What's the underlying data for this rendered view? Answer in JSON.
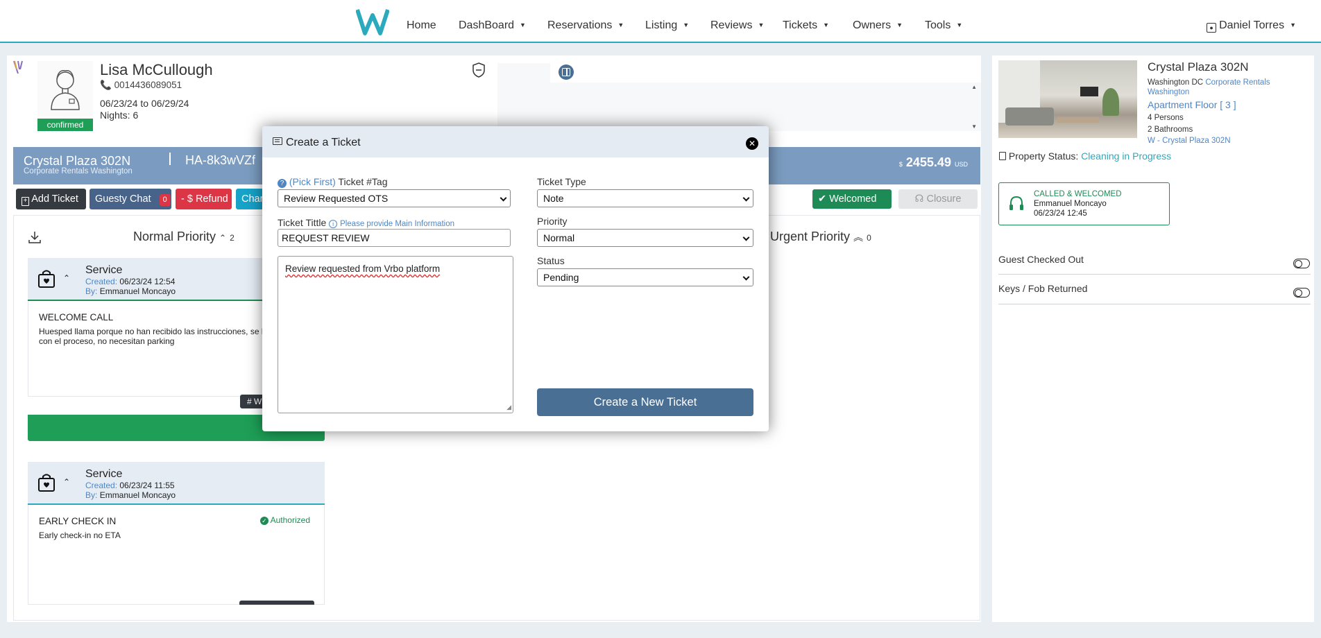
{
  "nav": {
    "items": [
      "Home",
      "DashBoard",
      "Reservations",
      "Listing",
      "Reviews",
      "Tickets",
      "Owners",
      "Tools"
    ],
    "user": "Daniel Torres"
  },
  "guest": {
    "name": "Lisa McCullough",
    "phone": "0014436089051",
    "dates": "06/23/24 to 06/29/24",
    "nights": "Nights: 6",
    "status": "confirmed"
  },
  "reservation_bar": {
    "property": "Crystal Plaza 302N",
    "subtitle": "Corporate Rentals Washington",
    "code": "HA-8k3wVZf",
    "price_symbol": "$",
    "price": "2455.49",
    "currency": "USD"
  },
  "actions": {
    "add_ticket": "Add Ticket",
    "guesty_chat": "Guesty Chat",
    "chat_count": "0",
    "refund": "- $ Refund",
    "charge": "Char",
    "welcomed": "Welcomed",
    "closure": "Closure"
  },
  "columns": {
    "normal": "Normal Priority",
    "normal_count": "2",
    "urgent": "Urgent Priority",
    "urgent_count": "0"
  },
  "tickets": [
    {
      "type": "Service",
      "created_label": "Created:",
      "created": "06/23/24 12:54",
      "by_label": "By:",
      "by": "Emmanuel Moncayo",
      "title": "WELCOME CALL",
      "body_line1": "Huesped llama porque no han recibido las instrucciones, se l",
      "body_line2": "con el proceso, no necesitan parking",
      "tag": "# W"
    },
    {
      "type": "Service",
      "created_label": "Created:",
      "created": "06/23/24 11:55",
      "by_label": "By:",
      "by": "Emmanuel Moncayo",
      "title": "EARLY CHECK IN",
      "body_line1": "Early check-in no ETA",
      "status": "Authorized"
    }
  ],
  "modal": {
    "title": "Create a Ticket",
    "pick_first": "(Pick First)",
    "tag_label": "Ticket #Tag",
    "tag_value": "Review Requested OTS",
    "title_label": "Ticket Tittle",
    "title_hint": "Please provide Main Information",
    "title_value": "REQUEST REVIEW",
    "description": "Review requested from Vrbo platform",
    "type_label": "Ticket Type",
    "type_value": "Note",
    "priority_label": "Priority",
    "priority_value": "Normal",
    "status_label": "Status",
    "status_value": "Pending",
    "submit": "Create a New Ticket"
  },
  "property": {
    "name": "Crystal Plaza 302N",
    "city": "Washington DC",
    "company": "Corporate Rentals Washington",
    "floor": "Apartment Floor [ 3 ]",
    "persons": "4 Persons",
    "bathrooms": "2 Bathrooms",
    "listing": "W - Crystal Plaza 302N",
    "status_label": "Property Status:",
    "status_value": "Cleaning in Progress"
  },
  "called": {
    "label": "CALLED & WELCOMED",
    "by": "Emmanuel Moncayo",
    "time": "06/23/24 12:45"
  },
  "checks": [
    {
      "label": "Guest Checked Out"
    },
    {
      "label": "Keys / Fob Returned"
    }
  ],
  "colors": {
    "accent": "#2ba9bd",
    "info_bar": "#7b9cc0",
    "success": "#1e9e56",
    "danger": "#dc3545",
    "primary_btn": "#4a6f94",
    "link": "#4f86c6"
  }
}
